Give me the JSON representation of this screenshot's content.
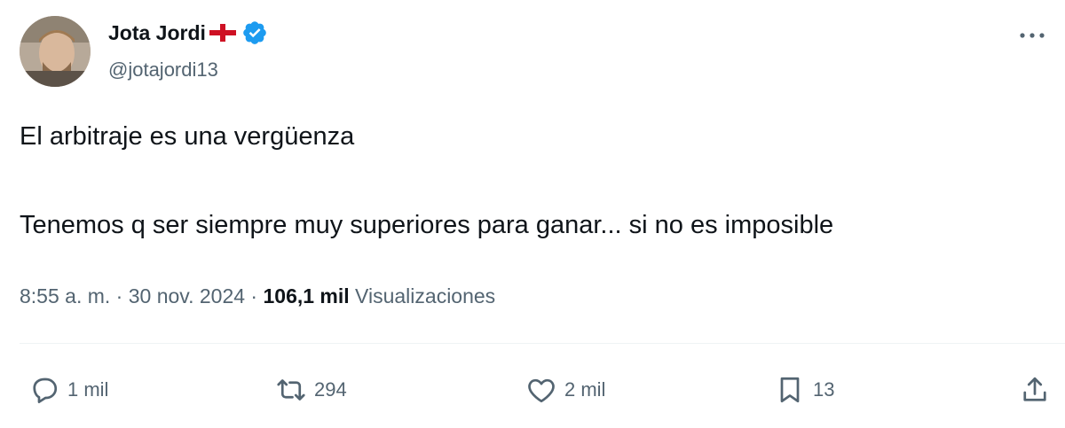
{
  "author": {
    "display_name": "Jota Jordi",
    "handle": "@jotajordi13",
    "flag_icon": "england-flag-icon",
    "verified_icon": "verified-badge-icon",
    "verified_color": "#1d9bf0"
  },
  "tweet": {
    "line1": "El arbitraje es una vergüenza",
    "line2": "Tenemos q ser siempre muy superiores para ganar... si no es imposible"
  },
  "meta": {
    "time": "8:55 a. m.",
    "separator1": " · ",
    "date": "30 nov. 2024",
    "separator2": " · ",
    "views_count": "106,1 mil",
    "views_label": " Visualizaciones"
  },
  "actions": {
    "replies": "1 mil",
    "retweets": "294",
    "likes": "2 mil",
    "bookmarks": "13"
  },
  "colors": {
    "text": "#0f1419",
    "secondary": "#536471",
    "divider": "#eff3f4"
  }
}
